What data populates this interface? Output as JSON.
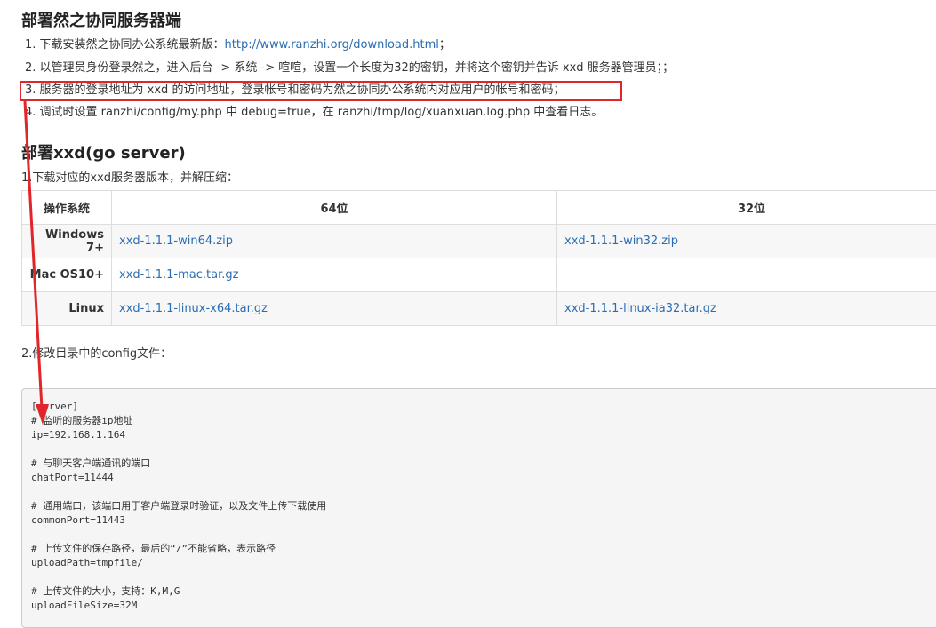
{
  "section1": {
    "title": "部署然之协同服务器端",
    "step1_prefix": "1. 下载安装然之协同办公系统最新版：",
    "step1_link": "http://www.ranzhi.org/download.html",
    "step1_suffix": "；",
    "step2": "2. 以管理员身份登录然之，进入后台 -> 系统 -> 喧喧，设置一个长度为32的密钥，并将这个密钥并告诉 xxd 服务器管理员；；",
    "step3": "3. 服务器的登录地址为 xxd 的访问地址，登录帐号和密码为然之协同办公系统内对应用户的帐号和密码；",
    "step4": "4. 调试时设置 ranzhi/config/my.php 中 debug=true，在 ranzhi/tmp/log/xuanxuan.log.php 中查看日志。"
  },
  "section2": {
    "title": "部署xxd(go server)",
    "step1": "1.下载对应的xxd服务器版本，并解压缩：",
    "step2": "2.修改目录中的config文件：",
    "table": {
      "headers": [
        "操作系统",
        "64位",
        "32位"
      ],
      "rows": [
        {
          "os": "Windows 7+",
          "x64": "xxd-1.1.1-win64.zip",
          "x32": "xxd-1.1.1-win32.zip"
        },
        {
          "os": "Mac OS10+",
          "x64": "xxd-1.1.1-mac.tar.gz",
          "x32": ""
        },
        {
          "os": "Linux",
          "x64": "xxd-1.1.1-linux-x64.tar.gz",
          "x32": "xxd-1.1.1-linux-ia32.tar.gz"
        }
      ]
    },
    "code_lines": [
      "[server]",
      "# 监听的服务器ip地址",
      "ip=192.168.1.164",
      "",
      "# 与聊天客户端通讯的端口",
      "chatPort=11444",
      "",
      "# 通用端口，该端口用于客户端登录时验证，以及文件上传下载使用",
      "commonPort=11443",
      "",
      "# 上传文件的保存路径，最后的“/”不能省略，表示路径",
      "uploadPath=tmpfile/",
      "",
      "# 上传文件的大小，支持：K,M,G",
      "uploadFileSize=32M"
    ]
  },
  "annotation": {
    "box_color": "#e0262a",
    "arrow_color": "#e0262a"
  }
}
